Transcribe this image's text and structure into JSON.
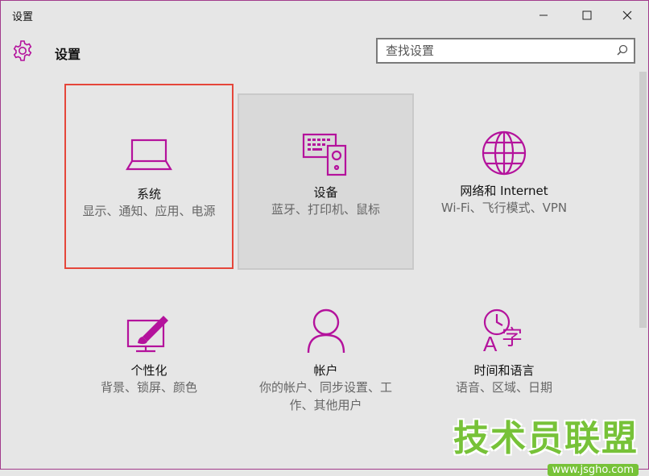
{
  "window": {
    "title": "设置",
    "controls": [
      "minimize",
      "maximize",
      "close"
    ]
  },
  "header": {
    "icon": "gear-icon",
    "title": "设置"
  },
  "search": {
    "placeholder": "查找设置",
    "icon": "search-icon"
  },
  "colors": {
    "accent": "#b4129c",
    "selected_border": "#e5463a",
    "background": "#e6e6e6",
    "watermark": "#77c238"
  },
  "tiles": [
    {
      "name": "系统",
      "desc": "显示、通知、应用、电源",
      "icon": "laptop-icon",
      "state": "selected"
    },
    {
      "name": "设备",
      "desc": "蓝牙、打印机、鼠标",
      "icon": "devices-icon",
      "state": "hover"
    },
    {
      "name": "网络和 Internet",
      "desc": "Wi-Fi、飞行模式、VPN",
      "icon": "globe-icon",
      "state": "normal"
    },
    {
      "name": "个性化",
      "desc": "背景、锁屏、颜色",
      "icon": "personalization-icon",
      "state": "normal"
    },
    {
      "name": "帐户",
      "desc": "你的帐户、同步设置、工作、其他用户",
      "icon": "person-icon",
      "state": "normal"
    },
    {
      "name": "时间和语言",
      "desc": "语音、区域、日期",
      "icon": "time-language-icon",
      "state": "normal"
    }
  ],
  "watermark": {
    "brand": "技术员联盟",
    "url": "www.jsgho.com"
  }
}
